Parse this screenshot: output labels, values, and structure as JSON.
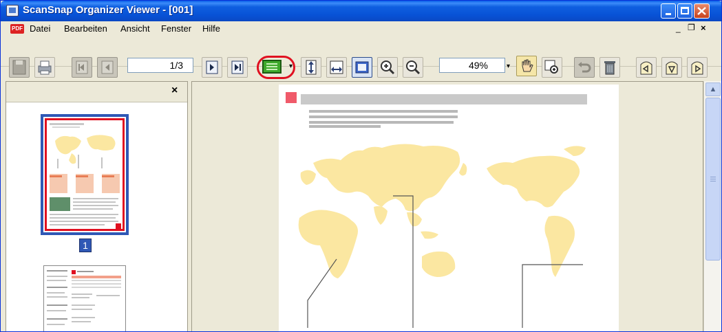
{
  "window": {
    "title": "ScanSnap Organizer Viewer - [001]"
  },
  "menubar": {
    "items": [
      "Datei",
      "Bearbeiten",
      "Ansicht",
      "Fenster",
      "Hilfe"
    ],
    "pdf_badge": "PDF"
  },
  "toolbar": {
    "page_indicator": "1/3",
    "zoom_value": "49%",
    "highlight_color": "#e01020"
  },
  "thumbnails": {
    "panel_close": "×",
    "items": [
      {
        "label": "1",
        "selected": true
      },
      {
        "label": "",
        "selected": false
      }
    ]
  },
  "icons": {
    "mdi_minimize": "_",
    "mdi_restore": "❐",
    "mdi_close": "×",
    "scroll_up": "▲",
    "dropdown_arrow": "▾"
  },
  "colors": {
    "title_blue": "#0852d6",
    "selection_blue": "#2f58b5",
    "map_yellow": "#fbe7a1"
  }
}
